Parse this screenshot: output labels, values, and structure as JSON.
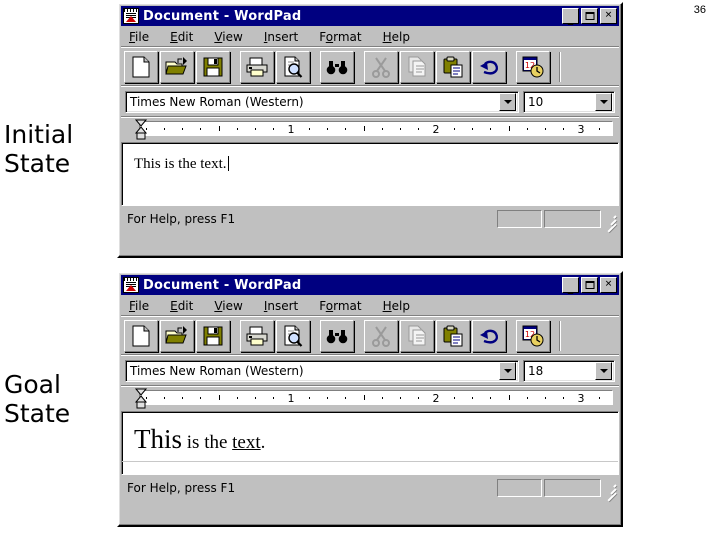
{
  "slide": {
    "number": "36"
  },
  "labels": {
    "initial_line1": "Initial",
    "initial_line2": "State",
    "goal_line1": "Goal",
    "goal_line2": "State"
  },
  "window": {
    "title": "Document - WordPad",
    "title_icon": "wordpad-document-icon",
    "controls": {
      "minimize": "minimize-button",
      "maximize": "maximize-button",
      "close": "close-button",
      "close_glyph": "✕",
      "minimize_glyph": "_"
    },
    "menu": [
      {
        "label": "File",
        "accel": "F"
      },
      {
        "label": "Edit",
        "accel": "E"
      },
      {
        "label": "View",
        "accel": "V"
      },
      {
        "label": "Insert",
        "accel": "I"
      },
      {
        "label": "Format",
        "accel": "o"
      },
      {
        "label": "Help",
        "accel": "H"
      }
    ],
    "toolbar": [
      {
        "name": "new-button",
        "tip": "New"
      },
      {
        "name": "open-button",
        "tip": "Open"
      },
      {
        "name": "save-button",
        "tip": "Save"
      },
      {
        "name": "print-button",
        "tip": "Print"
      },
      {
        "name": "print-preview-button",
        "tip": "Print Preview"
      },
      {
        "name": "find-button",
        "tip": "Find"
      },
      {
        "name": "cut-button",
        "tip": "Cut"
      },
      {
        "name": "copy-button",
        "tip": "Copy"
      },
      {
        "name": "paste-button",
        "tip": "Paste"
      },
      {
        "name": "undo-button",
        "tip": "Undo"
      },
      {
        "name": "date-time-button",
        "tip": "Date/Time"
      }
    ],
    "ruler": {
      "numbers": [
        "1",
        "2",
        "3"
      ]
    },
    "status": {
      "help_text": "For Help, press F1"
    }
  },
  "initial_state": {
    "font_name": "Times New Roman (Western)",
    "font_size": "10",
    "document_text": "This is the text."
  },
  "goal_state": {
    "font_name": "Times New Roman (Western)",
    "font_size": "18",
    "document_text_parts": {
      "big": "This",
      "middle": " is the ",
      "underlined": "text",
      "tail": "."
    }
  },
  "colors": {
    "titlebar": "#000080",
    "chrome": "#c0c0c0",
    "doc_bg": "#ffffff",
    "icon_olive": "#808000",
    "icon_blue": "#000080"
  }
}
